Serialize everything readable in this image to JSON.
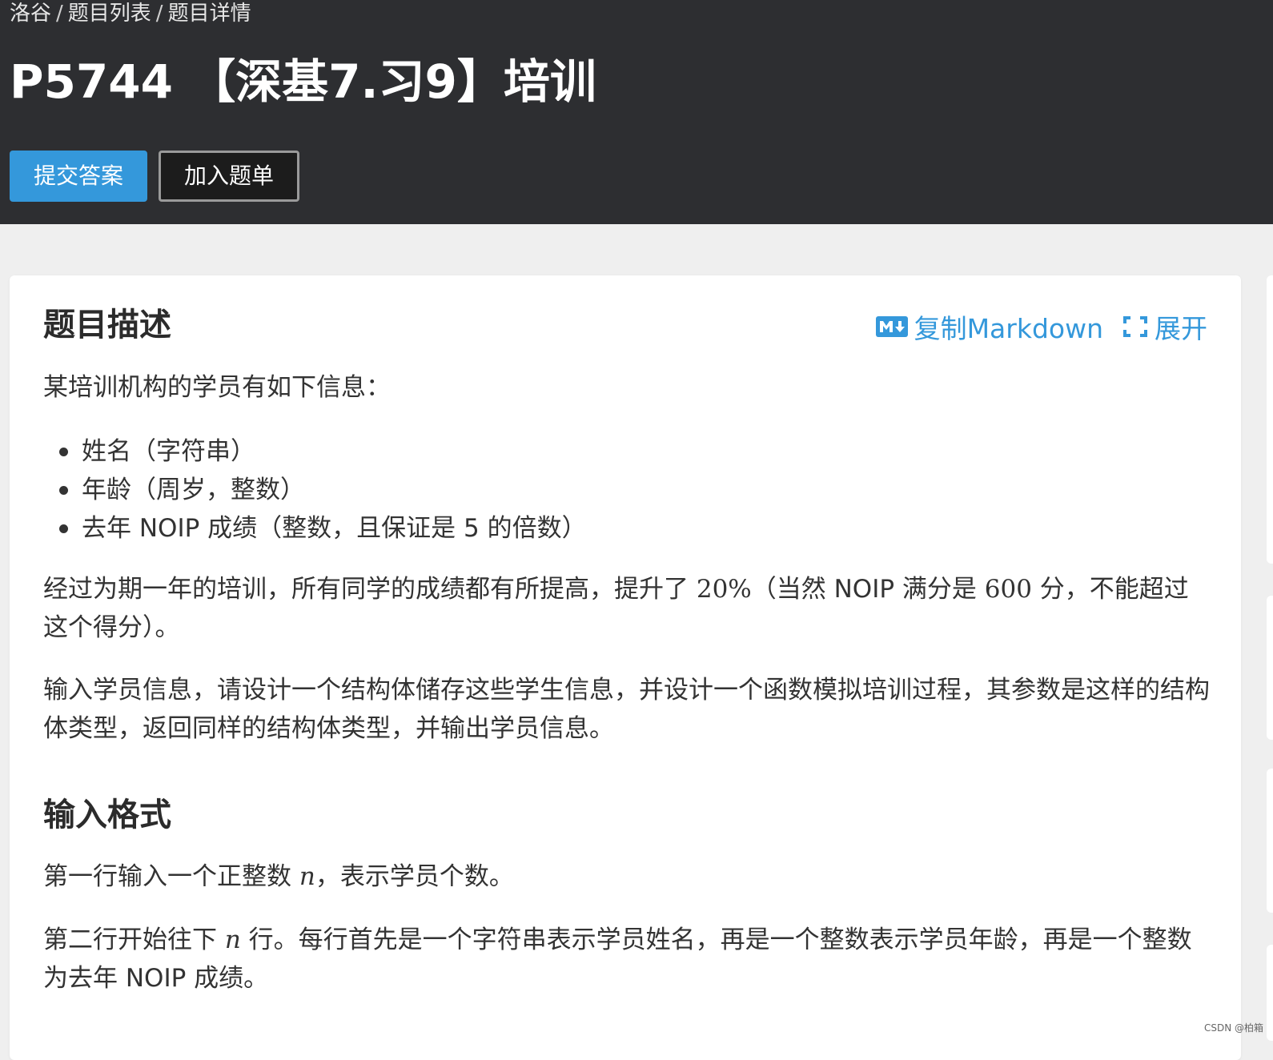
{
  "breadcrumb": {
    "items": [
      "洛谷",
      "题目列表",
      "题目详情"
    ],
    "separator": "/"
  },
  "problem": {
    "title": "P5744 【深基7.习9】培训"
  },
  "actions": {
    "submit_label": "提交答案",
    "add_to_list_label": "加入题单"
  },
  "tools": {
    "copy_markdown_label": "复制Markdown",
    "expand_label": "展开",
    "copy_markdown_icon": "markdown-icon",
    "expand_icon": "expand-icon"
  },
  "description": {
    "heading": "题目描述",
    "intro": "某培训机构的学员有如下信息：",
    "items": [
      "姓名（字符串）",
      "年龄（周岁，整数）",
      "去年 NOIP 成绩（整数，且保证是 5 的倍数）"
    ],
    "training_text": {
      "before": "经过为期一年的培训，所有同学的成绩都有所提高，提升了 ",
      "percent": "20%",
      "middle": "（当然 NOIP 满分是 ",
      "max_score": "600",
      "after": " 分，不能超过这个得分）。"
    },
    "task_text": "输入学员信息，请设计一个结构体储存这些学生信息，并设计一个函数模拟培训过程，其参数是这样的结构体类型，返回同样的结构体类型，并输出学员信息。"
  },
  "input_format": {
    "heading": "输入格式",
    "line1": {
      "before": "第一行输入一个正整数 ",
      "var": "n",
      "after": "，表示学员个数。"
    },
    "line2": {
      "before": "第二行开始往下 ",
      "var": "n",
      "after": " 行。每行首先是一个字符串表示学员姓名，再是一个整数表示学员年龄，再是一个整数为去年 NOIP 成绩。"
    }
  },
  "watermark": "CSDN @柏箱",
  "colors": {
    "header_bg": "#2d2e31",
    "accent": "#3498db",
    "page_bg": "#efefef",
    "card_bg": "#ffffff"
  }
}
